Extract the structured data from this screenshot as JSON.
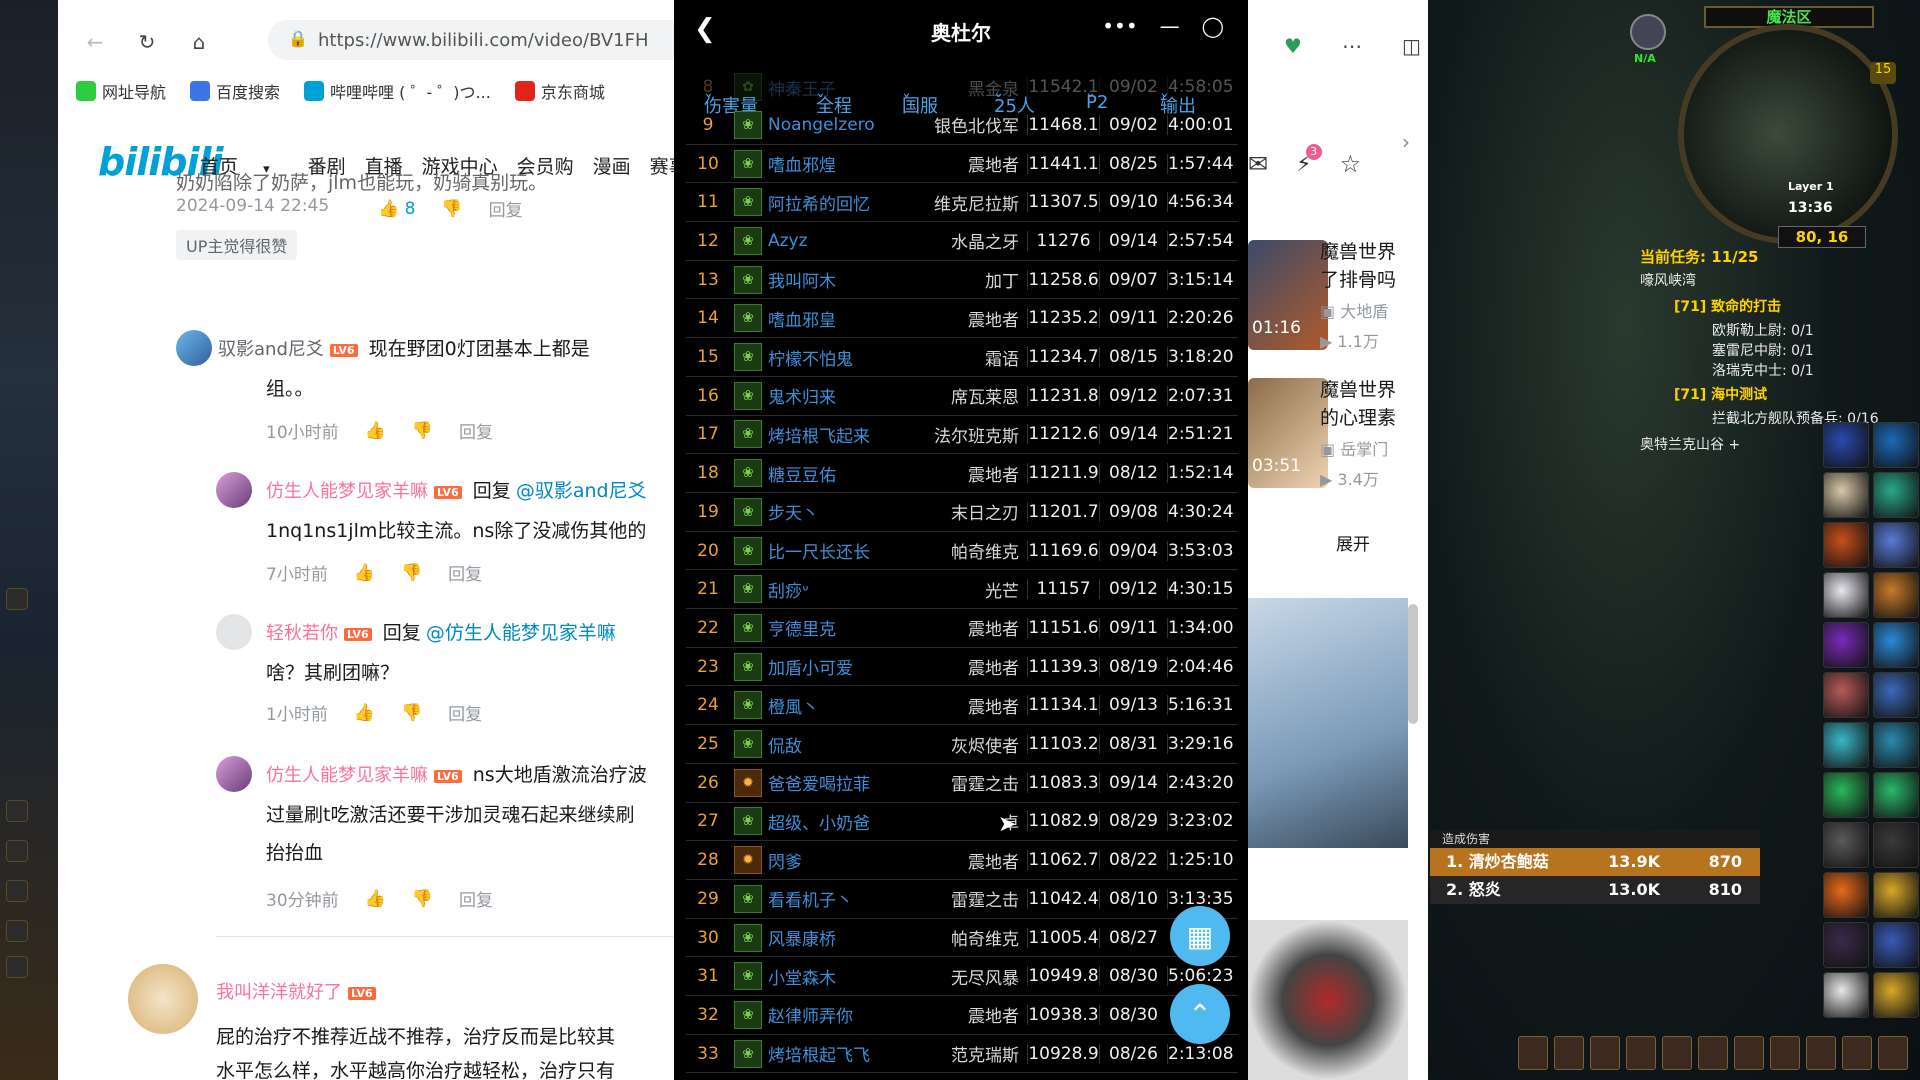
{
  "browser": {
    "url": "https://www.bilibili.com/video/BV1FH",
    "bookmarks": [
      "网址导航",
      "百度搜索",
      "哔哩哔哩 ( ゜- ゜)つ...",
      "京东商城"
    ],
    "bookmark_colors": [
      "#2ecc40",
      "#3b73e8",
      "#00a1d6",
      "#e1251b"
    ]
  },
  "site": {
    "logo": "bilibili",
    "nav": [
      "首页",
      "番剧",
      "直播",
      "游戏中心",
      "会员购",
      "漫画",
      "赛事"
    ],
    "nav_first_chevron": "chevron-down-icon",
    "notification_count": "3"
  },
  "comments": {
    "top_text_fragment": "奶奶陷除了奶萨，jlm也能玩，奶骑真别玩。",
    "top_time": "2024-09-14 22:45",
    "top_likes": "8",
    "reply_label": "回复",
    "up_badge": "UP主觉得很赞",
    "items": [
      {
        "user": "驭影and尼爻",
        "level": "LV6",
        "text1": "现在野团0灯团基本上都是",
        "text2": "组。。",
        "time": "10小时前"
      },
      {
        "user": "仿生人能梦见家羊嘛",
        "level": "LV6",
        "reply_to": "@驭影and尼爻",
        "reply_prefix": "回复",
        "text1": "1nq1ns1jlm比较主流。ns除了没减伤其他的",
        "time": "7小时前"
      },
      {
        "user": "轻秋若你",
        "level": "LV6",
        "reply_to": "@仿生人能梦见家羊嘛",
        "reply_prefix": "回复",
        "text1": "啥？其刷团嘛？",
        "time": "1小时前"
      },
      {
        "user": "仿生人能梦见家羊嘛",
        "level": "LV6",
        "text0": "ns大地盾激流治疗波",
        "text1": "过量刷t吃激活还要干涉加灵魂石起来继续刷",
        "text2": "抬抬血",
        "time": "30分钟前"
      },
      {
        "user": "我叫洋洋就好了",
        "level": "LV6",
        "text1": "屁的治疗不推荐近战不推荐，治疗反而是比较其",
        "text2": "水平怎么样，水平越高你治疗越轻松，治疗只有"
      }
    ]
  },
  "sidebar_videos": {
    "items": [
      {
        "title1": "魔兽世界",
        "title2": "了排骨吗",
        "up": "大地盾",
        "views": "1.1万",
        "duration": "01:16"
      },
      {
        "title1": "魔兽世界",
        "title2": "的心理素",
        "up": "岳掌门",
        "views": "3.4万",
        "duration": "03:51"
      }
    ],
    "expand": "展开"
  },
  "board": {
    "title": "奥杜尔",
    "back_icon": "chevron-left-icon",
    "filters": [
      "伤害量",
      "全程",
      "国服",
      "25人",
      "P2",
      "输出"
    ],
    "partial_row": {
      "rank": "8",
      "name": "神秦王子",
      "server": "黑金泉",
      "dps": "11542.1",
      "date": "09/02",
      "duration": "4:58:05"
    },
    "rows": [
      {
        "rank": "9",
        "name": "Noangelzero",
        "server": "银色北伐军",
        "dps": "11468.1",
        "date": "09/02",
        "duration": "4:00:01",
        "icon": "shaman"
      },
      {
        "rank": "10",
        "name": "嗜血邪煌",
        "server": "震地者",
        "dps": "11441.1",
        "date": "08/25",
        "duration": "1:57:44",
        "icon": "shaman"
      },
      {
        "rank": "11",
        "name": "阿拉希的回忆",
        "server": "维克尼拉斯",
        "dps": "11307.5",
        "date": "09/10",
        "duration": "4:56:34",
        "icon": "shaman"
      },
      {
        "rank": "12",
        "name": "Azyz",
        "server": "水晶之牙",
        "dps": "11276",
        "date": "09/14",
        "duration": "2:57:54",
        "icon": "shaman"
      },
      {
        "rank": "13",
        "name": "我叫阿木",
        "server": "加丁",
        "dps": "11258.6",
        "date": "09/07",
        "duration": "3:15:14",
        "icon": "shaman"
      },
      {
        "rank": "14",
        "name": "嗜血邪皇",
        "server": "震地者",
        "dps": "11235.2",
        "date": "09/11",
        "duration": "2:20:26",
        "icon": "shaman"
      },
      {
        "rank": "15",
        "name": "柠檬不怕鬼",
        "server": "霜语",
        "dps": "11234.7",
        "date": "08/15",
        "duration": "3:18:20",
        "icon": "shaman"
      },
      {
        "rank": "16",
        "name": "鬼术归来",
        "server": "席瓦莱恩",
        "dps": "11231.8",
        "date": "09/12",
        "duration": "2:07:31",
        "icon": "shaman"
      },
      {
        "rank": "17",
        "name": "烤培根飞起来",
        "server": "法尔班克斯",
        "dps": "11212.6",
        "date": "09/14",
        "duration": "2:51:21",
        "icon": "shaman"
      },
      {
        "rank": "18",
        "name": "糖豆豆佑",
        "server": "震地者",
        "dps": "11211.9",
        "date": "08/12",
        "duration": "1:52:14",
        "icon": "shaman"
      },
      {
        "rank": "19",
        "name": "步天丶",
        "server": "末日之刃",
        "dps": "11201.7",
        "date": "09/08",
        "duration": "4:30:24",
        "icon": "shaman"
      },
      {
        "rank": "20",
        "name": "比一尺长还长",
        "server": "帕奇维克",
        "dps": "11169.6",
        "date": "09/04",
        "duration": "3:53:03",
        "icon": "shaman"
      },
      {
        "rank": "21",
        "name": "刮痧ᐡ",
        "server": "光芒",
        "dps": "11157",
        "date": "09/12",
        "duration": "4:30:15",
        "icon": "shaman"
      },
      {
        "rank": "22",
        "name": "亨德里克",
        "server": "震地者",
        "dps": "11151.6",
        "date": "09/11",
        "duration": "1:34:00",
        "icon": "shaman"
      },
      {
        "rank": "23",
        "name": "加盾小可爱",
        "server": "震地者",
        "dps": "11139.3",
        "date": "08/19",
        "duration": "2:04:46",
        "icon": "shaman"
      },
      {
        "rank": "24",
        "name": "橙風丶",
        "server": "震地者",
        "dps": "11134.1",
        "date": "09/13",
        "duration": "5:16:31",
        "icon": "shaman"
      },
      {
        "rank": "25",
        "name": "侃敌",
        "server": "灰烬使者",
        "dps": "11103.2",
        "date": "08/31",
        "duration": "3:29:16",
        "icon": "shaman"
      },
      {
        "rank": "26",
        "name": "爸爸爱喝拉菲",
        "server": "雷霆之击",
        "dps": "11083.3",
        "date": "09/14",
        "duration": "2:43:20",
        "icon": "fire"
      },
      {
        "rank": "27",
        "name": "超级、小奶爸",
        "server": "卓",
        "dps": "11082.9",
        "date": "08/29",
        "duration": "3:23:02",
        "icon": "shaman"
      },
      {
        "rank": "28",
        "name": "閃爹",
        "server": "震地者",
        "dps": "11062.7",
        "date": "08/22",
        "duration": "1:25:10",
        "icon": "fire"
      },
      {
        "rank": "29",
        "name": "看看机子丶",
        "server": "雷霆之击",
        "dps": "11042.4",
        "date": "08/10",
        "duration": "3:13:35",
        "icon": "shaman"
      },
      {
        "rank": "30",
        "name": "风暴康桥",
        "server": "帕奇维克",
        "dps": "11005.4",
        "date": "08/27",
        "duration": "",
        "icon": "shaman"
      },
      {
        "rank": "31",
        "name": "小堂森木",
        "server": "无尽风暴",
        "dps": "10949.8",
        "date": "08/30",
        "duration": "5:06:23",
        "icon": "shaman"
      },
      {
        "rank": "32",
        "name": "赵律师弄你",
        "server": "震地者",
        "dps": "10938.3",
        "date": "08/30",
        "duration": "",
        "icon": "shaman"
      },
      {
        "rank": "33",
        "name": "烤培根起飞飞",
        "server": "范克瑞斯",
        "dps": "10928.9",
        "date": "08/26",
        "duration": "2:13:08",
        "icon": "shaman"
      }
    ],
    "colors": {
      "rank": "#e8a23a",
      "name": "#3f8fd8",
      "filter": "#4aa3e8",
      "fab": "#4fb9f0"
    }
  },
  "game": {
    "zone": "魔法区",
    "target_status": "N/A",
    "minimap_layer": "Layer 1",
    "clock": "13:36",
    "coords": "80, 16",
    "minimap_badge": "15",
    "quest_header": "当前任务: 11/25",
    "quest_zone": "嚎风峡湾",
    "quests": [
      {
        "title": "[71] 致命的打击",
        "objectives": [
          "欧斯勒上尉: 0/1",
          "塞雷尼中尉: 0/1",
          "洛瑞克中士: 0/1"
        ]
      },
      {
        "title": "[71] 海中测试",
        "objectives": [
          "拦截北方舰队预备兵: 0/16"
        ]
      }
    ],
    "quest_footer": "奥特兰克山谷 +",
    "damage_meter": {
      "title": "造成伤害",
      "rows": [
        {
          "rank": "1.",
          "name": "清炒杏鲍菇",
          "value": "13.9K",
          "dps": "870"
        },
        {
          "rank": "2.",
          "name": "怒炎",
          "value": "13.0K",
          "dps": "810"
        }
      ]
    }
  }
}
